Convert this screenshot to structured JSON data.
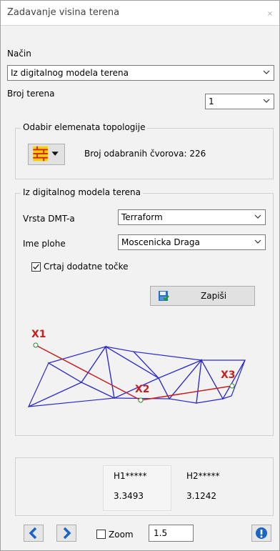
{
  "window": {
    "title": "Zadavanje visina terena",
    "close": "×"
  },
  "nacin": {
    "label": "Način",
    "value": "Iz digitalnog modela terena"
  },
  "broj_terena": {
    "label": "Broj terena",
    "value": "1"
  },
  "topology_group": {
    "title": "Odabir elemenata topologije",
    "selected_text": "Broj odabranih čvorova: 226"
  },
  "dmt_group": {
    "title": "Iz digitalnog modela terena",
    "vrsta_label": "Vrsta DMT-a",
    "vrsta_value": "Terraform",
    "ime_label": "Ime plohe",
    "ime_value": "Moscenicka Draga",
    "checkbox_label": "Crtaj dodatne točke",
    "checkbox_checked": true,
    "save_label": "Zapiši"
  },
  "diagram": {
    "point_labels": [
      "X1",
      "X2",
      "X3"
    ]
  },
  "heights": {
    "h1_label": "H1*****",
    "h1_value": "3.3493",
    "h2_label": "H2*****",
    "h2_value": "3.1242"
  },
  "footer": {
    "zoom_label": "Zoom",
    "zoom_value": "1.5"
  },
  "colors": {
    "accent_blue": "#1a64c8",
    "triangle_blue": "#2a2ad0",
    "line_red": "#c81e1e"
  }
}
